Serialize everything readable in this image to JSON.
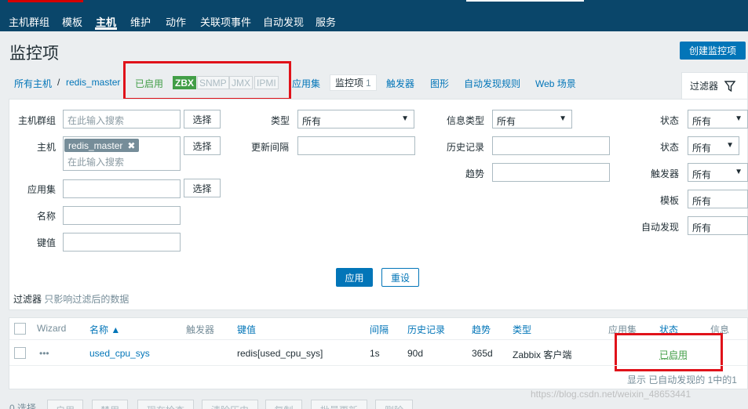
{
  "nav": {
    "items": [
      {
        "label": "主机群组"
      },
      {
        "label": "模板"
      },
      {
        "label": "主机"
      },
      {
        "label": "维护"
      },
      {
        "label": "动作"
      },
      {
        "label": "关联项事件"
      },
      {
        "label": "自动发现"
      },
      {
        "label": "服务"
      }
    ],
    "active": "主机"
  },
  "header": {
    "title": "监控项",
    "create_button": "创建监控项"
  },
  "breadcrumb": {
    "all_hosts": "所有主机",
    "sep": "/",
    "host": "redis_master",
    "status": "已启用",
    "tags": [
      "ZBX",
      "SNMP",
      "JMX",
      "IPMI"
    ],
    "tabs": [
      "应用集",
      "监控项",
      "触发器",
      "图形",
      "自动发现规则",
      "Web 场景"
    ],
    "current_tab_count": "1",
    "filter_tab": "过滤器"
  },
  "filter": {
    "host_group": {
      "label": "主机群组",
      "placeholder": "在此输入搜索",
      "button": "选择"
    },
    "host": {
      "label": "主机",
      "chip": "redis_master",
      "chip_remove": "✖",
      "placeholder": "在此输入搜索",
      "button": "选择"
    },
    "application": {
      "label": "应用集",
      "button": "选择"
    },
    "name": {
      "label": "名称"
    },
    "key": {
      "label": "键值"
    },
    "type": {
      "label": "类型",
      "value": "所有"
    },
    "update_interval": {
      "label": "更新间隔"
    },
    "info_type": {
      "label": "信息类型",
      "value": "所有"
    },
    "history": {
      "label": "历史记录"
    },
    "trends": {
      "label": "趋势"
    },
    "state": {
      "label": "状态",
      "value": "所有"
    },
    "status": {
      "label": "状态",
      "value": "所有"
    },
    "triggers": {
      "label": "触发器",
      "value": "所有"
    },
    "template": {
      "label": "模板",
      "value": "所有"
    },
    "discovery": {
      "label": "自动发现",
      "value": "所有"
    },
    "apply_button": "应用",
    "reset_button": "重设",
    "note_title": "过滤器",
    "note_text": "只影响过滤后的数据"
  },
  "table": {
    "headers": {
      "wizard": "Wizard",
      "name": "名称 ▲",
      "triggers": "触发器",
      "key": "键值",
      "interval": "间隔",
      "history": "历史记录",
      "trends": "趋势",
      "type": "类型",
      "applications": "应用集",
      "status": "状态",
      "info": "信息"
    },
    "rows": [
      {
        "wizard": "•••",
        "name": "used_cpu_sys",
        "key": "redis[used_cpu_sys]",
        "interval": "1s",
        "history": "90d",
        "trends": "365d",
        "type": "Zabbix 客户端",
        "status": "已启用"
      }
    ],
    "pager": "显示 已自动发现的 1中的1"
  },
  "footer": {
    "selected": "0 选择",
    "buttons": [
      "启用",
      "禁用",
      "现在检查",
      "清除历史",
      "复制",
      "批量更新",
      "删除"
    ]
  },
  "watermark": "https://blog.csdn.net/weixin_48653441",
  "colors": {
    "nav_bg": "#0a466a",
    "link": "#0275b8",
    "enabled_green": "#429e47",
    "highlight_red": "#e0121a"
  }
}
